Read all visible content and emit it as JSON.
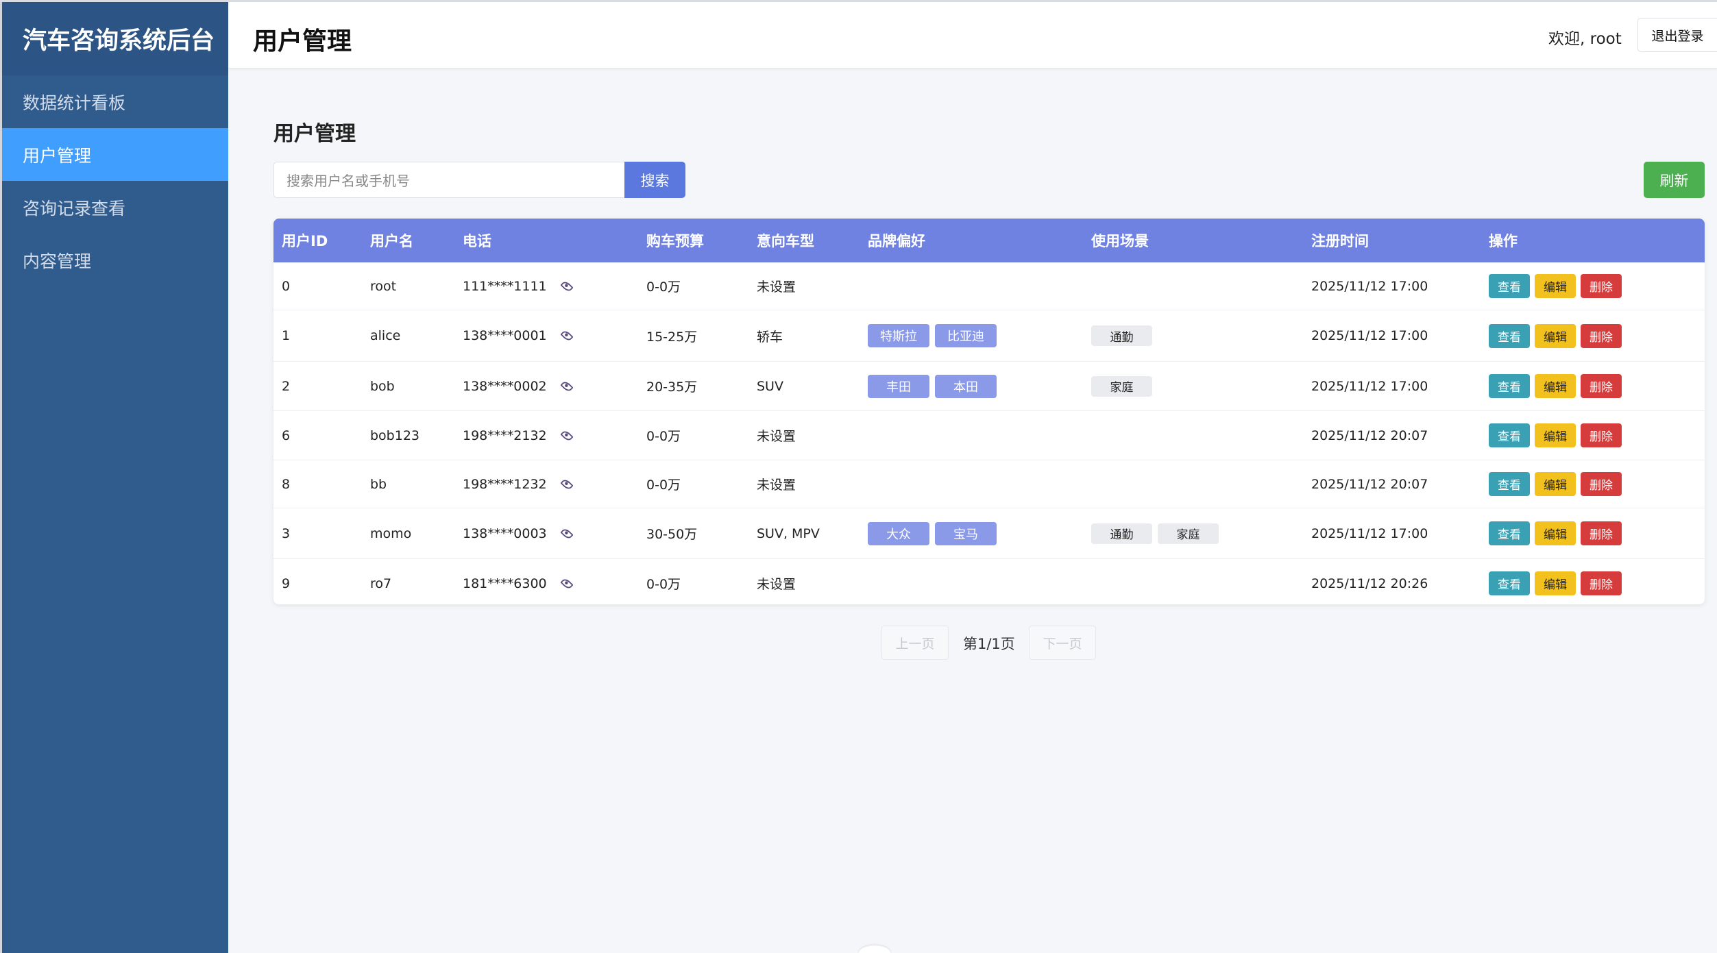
{
  "sidebar": {
    "brand": "汽车咨询系统后台",
    "items": [
      {
        "label": "数据统计看板",
        "active": false
      },
      {
        "label": "用户管理",
        "active": true
      },
      {
        "label": "咨询记录查看",
        "active": false
      },
      {
        "label": "内容管理",
        "active": false
      }
    ]
  },
  "header": {
    "title": "用户管理",
    "welcome": "欢迎, root",
    "logout_label": "退出登录"
  },
  "main": {
    "section_title": "用户管理",
    "search_placeholder": "搜索用户名或手机号",
    "search_label": "搜索",
    "refresh_label": "刷新"
  },
  "table": {
    "columns": [
      "用户ID",
      "用户名",
      "电话",
      "购车预算",
      "意向车型",
      "品牌偏好",
      "使用场景",
      "注册时间",
      "操作"
    ],
    "rows": [
      {
        "id": "0",
        "name": "root",
        "phone": "111****1111",
        "budget": "0-0万",
        "model": "未设置",
        "brands": [],
        "scenes": [],
        "time": "2025/11/12 17:00"
      },
      {
        "id": "1",
        "name": "alice",
        "phone": "138****0001",
        "budget": "15-25万",
        "model": "轿车",
        "brands": [
          "特斯拉",
          "比亚迪"
        ],
        "scenes": [
          "通勤"
        ],
        "time": "2025/11/12 17:00"
      },
      {
        "id": "2",
        "name": "bob",
        "phone": "138****0002",
        "budget": "20-35万",
        "model": "SUV",
        "brands": [
          "丰田",
          "本田"
        ],
        "scenes": [
          "家庭"
        ],
        "time": "2025/11/12 17:00"
      },
      {
        "id": "6",
        "name": "bob123",
        "phone": "198****2132",
        "budget": "0-0万",
        "model": "未设置",
        "brands": [],
        "scenes": [],
        "time": "2025/11/12 20:07"
      },
      {
        "id": "8",
        "name": "bb",
        "phone": "198****1232",
        "budget": "0-0万",
        "model": "未设置",
        "brands": [],
        "scenes": [],
        "time": "2025/11/12 20:07"
      },
      {
        "id": "3",
        "name": "momo",
        "phone": "138****0003",
        "budget": "30-50万",
        "model": "SUV, MPV",
        "brands": [
          "大众",
          "宝马"
        ],
        "scenes": [
          "通勤",
          "家庭"
        ],
        "time": "2025/11/12 17:00"
      },
      {
        "id": "9",
        "name": "ro7",
        "phone": "181****6300",
        "budget": "0-0万",
        "model": "未设置",
        "brands": [],
        "scenes": [],
        "time": "2025/11/12 20:26"
      }
    ],
    "actions": {
      "view": "查看",
      "edit": "编辑",
      "delete": "删除"
    }
  },
  "pagination": {
    "prev_label": "上一页",
    "page_info": "第1/1页",
    "next_label": "下一页"
  },
  "colors": {
    "sidebar_bg": "#2f5b8d",
    "nav_active": "#409eff",
    "table_header": "#6f82e2",
    "search_button": "#5a78de",
    "refresh_button": "#4caf50",
    "view_button": "#3aa0b4",
    "edit_button": "#f2c11e",
    "delete_button": "#d63c3c"
  }
}
